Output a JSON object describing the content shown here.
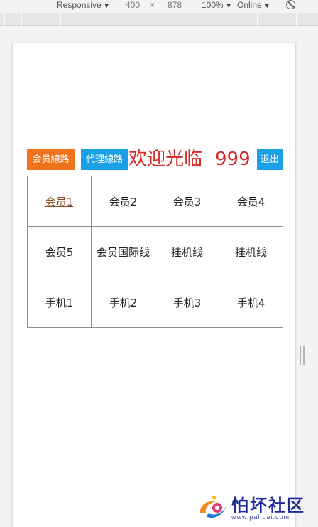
{
  "devtools": {
    "device_mode": "Responsive",
    "width": "400",
    "times": "×",
    "height": "878",
    "zoom": "100%",
    "network": "Online"
  },
  "header": {
    "member_route_button": "会员線路",
    "agent_route_button": "代理線路",
    "welcome_text": "欢迎光临",
    "username": "999",
    "logout_button": "退出"
  },
  "grid": {
    "rows": [
      [
        "会员1",
        "会员2",
        "会员3",
        "会员4"
      ],
      [
        "会员5",
        "会员国际线",
        "挂机线",
        "挂机线"
      ],
      [
        "手机1",
        "手机2",
        "手机3",
        "手机4"
      ]
    ]
  },
  "watermark": {
    "title": "怕坏社区",
    "url": "www.pahuai.com"
  },
  "colors": {
    "member_button": "#f0731b",
    "agent_button": "#1aa0e6",
    "welcome_text": "#d42a2a",
    "visited_link": "#8a4b25"
  }
}
